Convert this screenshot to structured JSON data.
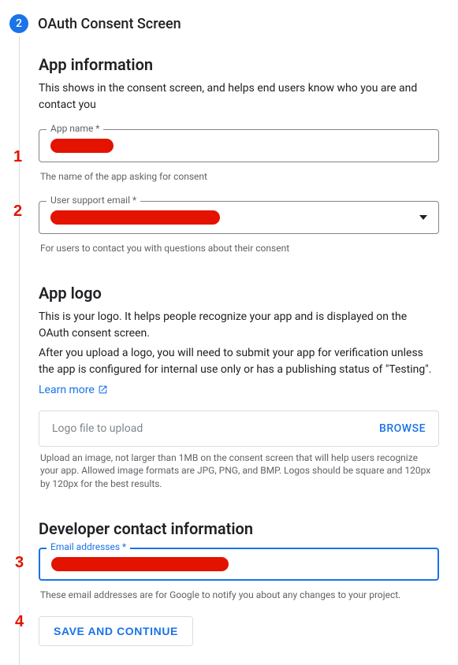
{
  "step": {
    "number": "2",
    "title": "OAuth Consent Screen"
  },
  "appInfo": {
    "heading": "App information",
    "desc": "This shows in the consent screen, and helps end users know who you are and contact you",
    "appName": {
      "label": "App name *",
      "helper": "The name of the app asking for consent"
    },
    "supportEmail": {
      "label": "User support email *",
      "helper": "For users to contact you with questions about their consent"
    }
  },
  "appLogo": {
    "heading": "App logo",
    "desc1": "This is your logo. It helps people recognize your app and is displayed on the OAuth consent screen.",
    "desc2": "After you upload a logo, you will need to submit your app for verification unless the app is configured for internal use only or has a publishing status of \"Testing\".",
    "learnMore": "Learn more",
    "upload": {
      "placeholder": "Logo file to upload",
      "browse": "BROWSE",
      "helper": "Upload an image, not larger than 1MB on the consent screen that will help users recognize your app. Allowed image formats are JPG, PNG, and BMP. Logos should be square and 120px by 120px for the best results."
    }
  },
  "devContact": {
    "heading": "Developer contact information",
    "email": {
      "label": "Email addresses *",
      "helper": "These email addresses are for Google to notify you about any changes to your project."
    }
  },
  "buttons": {
    "saveContinue": "SAVE AND CONTINUE"
  },
  "annot": {
    "n1": "1",
    "n2": "2",
    "n3": "3",
    "n4": "4"
  }
}
